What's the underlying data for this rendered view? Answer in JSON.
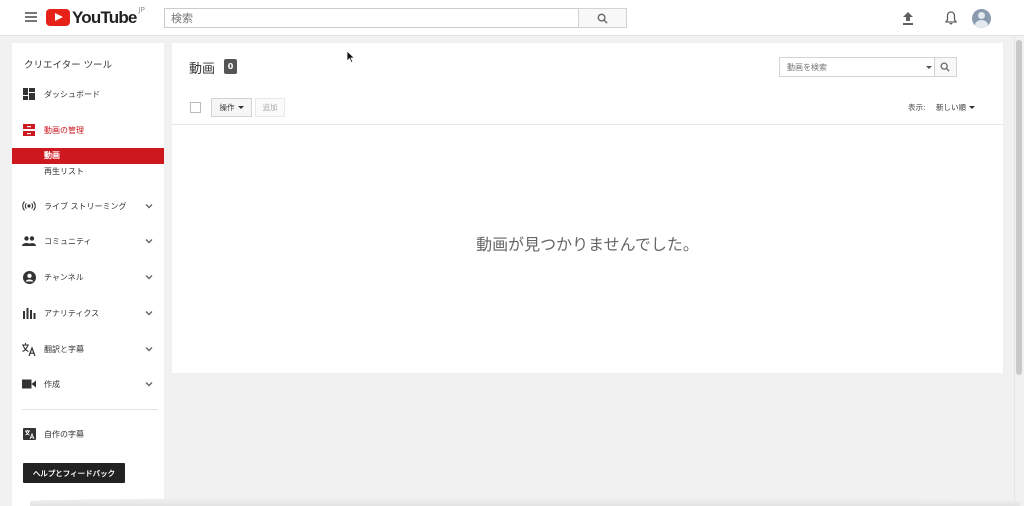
{
  "header": {
    "logo_text": "YouTube",
    "logo_region": "JP",
    "search_placeholder": "検索",
    "icons": [
      "menu-icon",
      "search-icon",
      "upload-icon",
      "bell-icon",
      "avatar"
    ]
  },
  "sidebar": {
    "title": "クリエイター ツール",
    "items": [
      {
        "label": "ダッシュボード",
        "icon": "dashboard-icon"
      },
      {
        "label": "動画の管理",
        "icon": "video-manager-icon",
        "active": true
      },
      {
        "label": "ライブ ストリーミング",
        "icon": "live-icon"
      },
      {
        "label": "コミュニティ",
        "icon": "community-icon"
      },
      {
        "label": "チャンネル",
        "icon": "channel-icon"
      },
      {
        "label": "アナリティクス",
        "icon": "analytics-icon"
      },
      {
        "label": "翻訳と字幕",
        "icon": "translate-icon"
      },
      {
        "label": "作成",
        "icon": "camera-icon"
      }
    ],
    "subitems": [
      {
        "label": "動画",
        "active": true
      },
      {
        "label": "再生リスト"
      }
    ],
    "subtitles_label": "自作の字幕",
    "help_button": "ヘルプとフィードバック"
  },
  "main": {
    "title": "動画",
    "count": "0",
    "search_placeholder": "動画を検索",
    "actions_label": "操作",
    "add_label": "追加",
    "sort_label": "表示:",
    "sort_value": "新しい順",
    "empty_message": "動画が見つかりませんでした。"
  },
  "colors": {
    "accent": "#cc181e",
    "logo_red": "#e62117",
    "background": "#f1f1f1"
  }
}
